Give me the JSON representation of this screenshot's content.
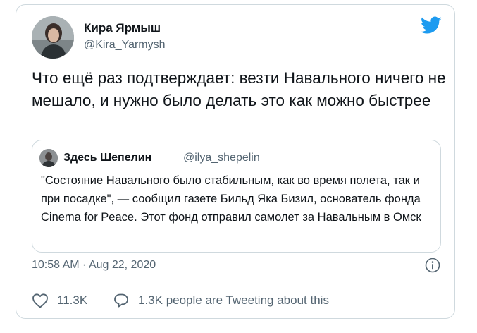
{
  "author": {
    "name": "Кира Ярмыш",
    "handle": "@Kira_Yarmysh"
  },
  "tweet": {
    "text": "Что ещё раз подтверждает: везти Навального ничего не мешало, и нужно было делать это как можно быстрее"
  },
  "quote": {
    "name": "Здесь Шепелин",
    "handle": "@ilya_shepelin",
    "text": "\"Состояние Навального было стабильным, как во время полета, так и при посадке\", — сообщил газете Бильд Яка Бизил, основатель фонда Cinema for Peace. Этот фонд отправил самолет за Навальным в Омск"
  },
  "meta": {
    "timestamp": "10:58 AM · Aug 22, 2020"
  },
  "actions": {
    "like_count": "11.3K",
    "reply_label": "1.3K people are Tweeting about this"
  },
  "icons": {
    "brand": "twitter-bird-icon",
    "info": "info-icon",
    "like": "heart-icon",
    "reply": "speech-bubble-icon"
  },
  "colors": {
    "brand_blue": "#1d9bf0",
    "secondary_text": "#536471",
    "border": "#cfd9de"
  }
}
